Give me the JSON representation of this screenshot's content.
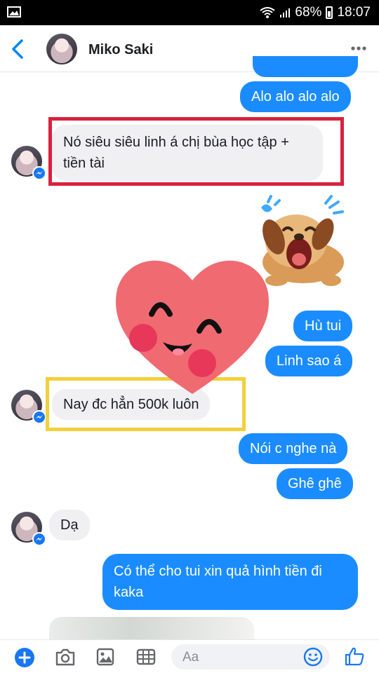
{
  "status_bar": {
    "battery": "68%",
    "time": "18:07"
  },
  "header": {
    "contact_name": "Miko Saki"
  },
  "messages": [
    {
      "text": "Alo alo alo alo"
    },
    {
      "text": "Nó siêu siêu linh á chị bùa học tập + tiền tài"
    },
    {
      "text": "Hù tui"
    },
    {
      "text": "Linh sao á"
    },
    {
      "text": "Nay đc hẳn 500k luôn"
    },
    {
      "text": "Nói c nghe nà"
    },
    {
      "text": "Ghê ghê"
    },
    {
      "text": "Dạ"
    },
    {
      "text": "Có thể cho tui xin quả hình tiền đi kaka"
    }
  ],
  "composer": {
    "placeholder": "Aa"
  },
  "colors": {
    "outgoing": "#1a8cff",
    "incoming": "#f0f0f3",
    "messenger_blue": "#1877f2",
    "highlight_red": "#d8223e",
    "highlight_yellow": "#f2d03a",
    "heart": "#f06a72"
  },
  "icons": [
    "back-icon",
    "more-icon",
    "messenger-badge-icon",
    "plus-icon",
    "camera-icon",
    "gallery-icon",
    "keyboard-icon",
    "emoji-icon",
    "thumbs-up-icon"
  ]
}
